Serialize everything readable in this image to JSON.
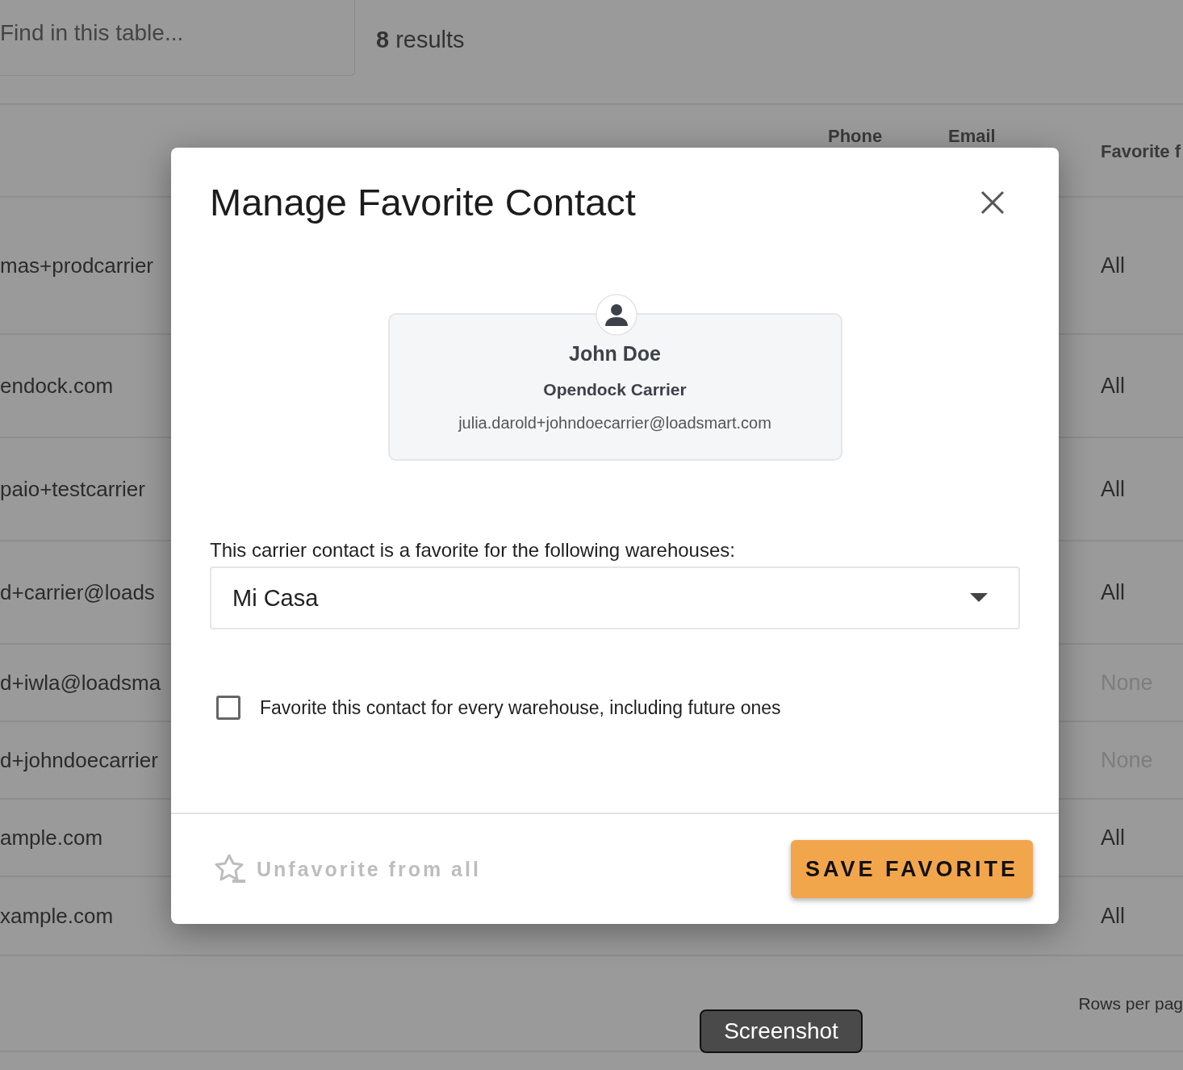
{
  "search": {
    "placeholder": "Find in this table..."
  },
  "result_count": "**8** results",
  "table": {
    "columns": [
      {
        "label": "Phone"
      },
      {
        "label": "Email"
      },
      {
        "label": "Favorite f"
      }
    ],
    "rows": [
      {
        "email": "mas+prodcarrier",
        "favorite": "All",
        "dimmed": false
      },
      {
        "email": "endock.com",
        "favorite": "All",
        "dimmed": false
      },
      {
        "email": "paio+testcarrier",
        "favorite": "All",
        "dimmed": false
      },
      {
        "email": "d+carrier@loads",
        "favorite": "All",
        "dimmed": false
      },
      {
        "email": "d+iwla@loadsma",
        "favorite": "None",
        "dimmed": true
      },
      {
        "email": "d+johndoecarrier",
        "favorite": "None",
        "dimmed": true
      },
      {
        "email": "ample.com",
        "favorite": "All",
        "dimmed": false
      },
      {
        "email": "xample.com",
        "favorite": "All",
        "dimmed": false
      }
    ]
  },
  "pagination": {
    "rows_per_page_label": "Rows per pag"
  },
  "modal": {
    "title": "Manage Favorite Contact",
    "contact": {
      "name": "John Doe",
      "company": "Opendock Carrier",
      "email": "julia.darold+johndoecarrier@loadsmart.com"
    },
    "warehouses_label": "This carrier contact is a favorite for the following warehouses:",
    "warehouse_select": {
      "value": "Mi Casa"
    },
    "all_warehouses_checkbox": {
      "label": "Favorite this contact for every warehouse, including future ones",
      "checked": false
    },
    "unfavorite_button": {
      "label": "Unfavorite from all",
      "disabled": true
    },
    "save_button": {
      "label": "SAVE FAVORITE"
    }
  },
  "tooltip": {
    "text": "Screenshot"
  }
}
